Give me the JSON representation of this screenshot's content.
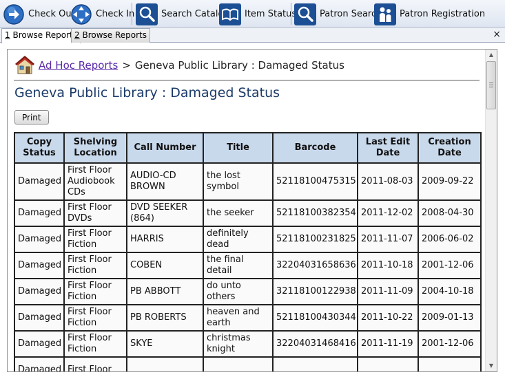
{
  "toolbar": {
    "buttons": [
      {
        "label": "Check Out",
        "icon": "arrow-right-icon"
      },
      {
        "label": "Check In",
        "icon": "compass-arrows-icon"
      },
      {
        "label": "Search Catalog",
        "icon": "magnifier-icon"
      },
      {
        "label": "Item Status",
        "icon": "open-book-icon"
      },
      {
        "label": "Patron Search",
        "icon": "magnifier-icon"
      },
      {
        "label": "Patron Registration",
        "icon": "people-icon"
      }
    ]
  },
  "tabs": [
    {
      "number": "1",
      "label": " Browse Reports",
      "active": true
    },
    {
      "number": "2",
      "label": " Browse Reports",
      "active": false
    }
  ],
  "tab_close": "×",
  "breadcrumb": {
    "link": "Ad Hoc Reports",
    "separator": ">",
    "current": "Geneva Public Library : Damaged Status"
  },
  "page_title": "Geneva Public Library : Damaged Status",
  "print_label": "Print",
  "table": {
    "headers": [
      "Copy Status",
      "Shelving Location",
      "Call Number",
      "Title",
      "Barcode",
      "Last Edit Date",
      "Creation Date"
    ],
    "rows": [
      [
        "Damaged",
        "First Floor Audiobook CDs",
        "AUDIO-CD BROWN",
        "the lost symbol",
        "52118100475315",
        "2011-08-03",
        "2009-09-22"
      ],
      [
        "Damaged",
        "First Floor DVDs",
        "DVD SEEKER (864)",
        "the seeker",
        "52118100382354",
        "2011-12-02",
        "2008-04-30"
      ],
      [
        "Damaged",
        "First Floor Fiction",
        "HARRIS",
        "definitely dead",
        "52118100231825",
        "2011-11-07",
        "2006-06-02"
      ],
      [
        "Damaged",
        "First Floor Fiction",
        "COBEN",
        "the final detail",
        "32204031658636",
        "2011-10-18",
        "2001-12-06"
      ],
      [
        "Damaged",
        "First Floor Fiction",
        "PB ABBOTT",
        "do unto others",
        "32118100122938",
        "2011-11-09",
        "2004-10-18"
      ],
      [
        "Damaged",
        "First Floor Fiction",
        "PB ROBERTS",
        "heaven and earth",
        "52118100430344",
        "2011-10-22",
        "2009-01-13"
      ],
      [
        "Damaged",
        "First Floor Fiction",
        "SKYE",
        "christmas knight",
        "32204031468416",
        "2011-11-19",
        "2001-12-06"
      ],
      [
        "Damaged",
        "First Floor",
        "",
        "",
        "",
        "",
        ""
      ]
    ]
  },
  "colors": {
    "header_bg": "#c9d9ec",
    "title": "#1c3b6a",
    "link": "#5a2aa8"
  }
}
